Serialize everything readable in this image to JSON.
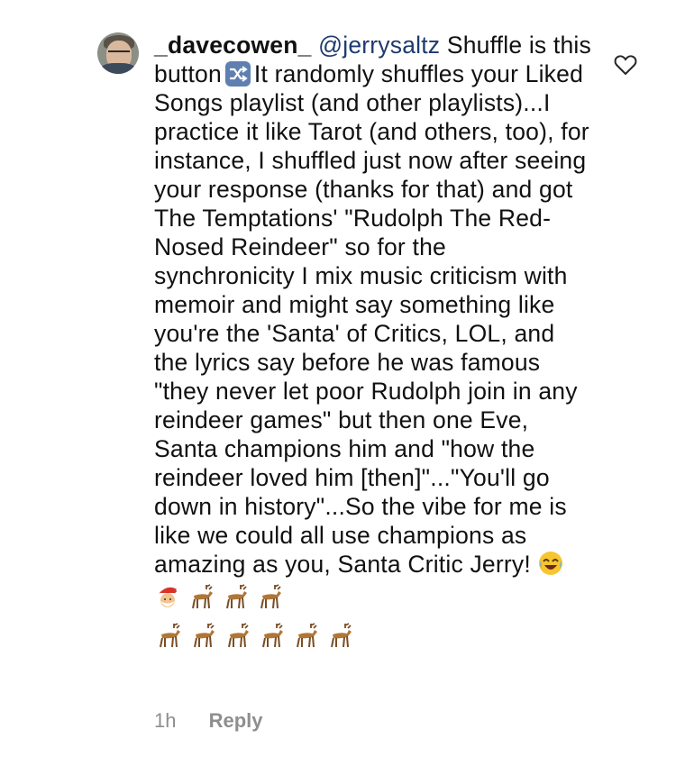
{
  "comment": {
    "username": "_davecowen_",
    "mention": "@jerrysaltz",
    "text_1": "Shuffle is this button",
    "shuffle_icon": "shuffle-icon",
    "text_2": "It randomly shuffles your Liked Songs playlist (and other playlists)...I practice it like Tarot (and others, too), for instance, I shuffled just now after seeing your response (thanks for that) and got The Temptations' \"Rudolph The Red-Nosed Reindeer\" so for the synchronicity I mix music criticism with memoir and might say something like you're the 'Santa' of Critics, LOL, and the lyrics say before he was famous \"they never let poor Rudolph join in any reindeer games\" but then one Eve, Santa champions him and \"how the reindeer loved him [then]\"...\"You'll go down in history\"...So the vibe for me is like we could all use champions as amazing as you, Santa Critic Jerry!",
    "emojis": [
      "laughing-tears-emoji",
      "santa-emoji",
      "deer-emoji",
      "deer-emoji",
      "deer-emoji",
      "deer-emoji",
      "deer-emoji",
      "deer-emoji",
      "deer-emoji",
      "deer-emoji",
      "deer-emoji"
    ],
    "time": "1h",
    "reply_label": "Reply"
  },
  "colors": {
    "mention": "#1d3b6e",
    "meta": "#8e8e8e",
    "shuffle_icon_bg": "#5e7fb0"
  },
  "icons": {
    "like": "heart-icon"
  }
}
